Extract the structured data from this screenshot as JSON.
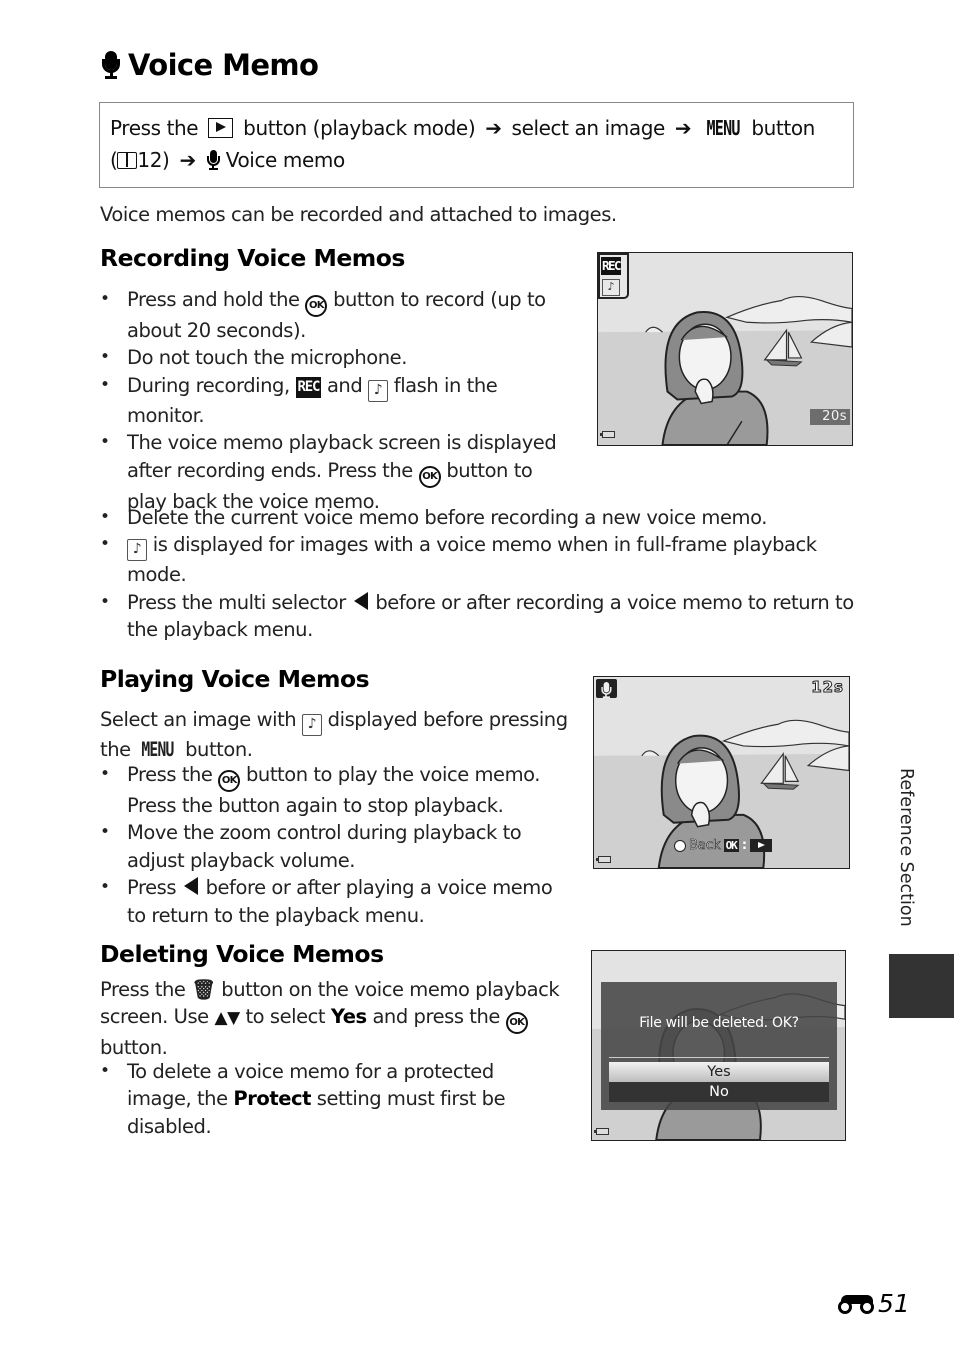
{
  "page": {
    "title": "Voice Memo",
    "title_icon": "microphone-icon",
    "nav": {
      "press_the": "Press the",
      "playback_button_icon": "playback-button-icon",
      "button_playback_mode": "button (playback mode)",
      "arrow": "➔",
      "select_image": "select an image",
      "menu_glyph": "MENU",
      "button": "button",
      "ref_open": "(",
      "ref_icon": "book-icon",
      "ref_page": "12)",
      "voice_memo": "Voice memo"
    },
    "intro": "Voice memos can be recorded and attached to images.",
    "side_tab_label": "Reference Section",
    "page_number_prefix_icon": "binoculars-icon",
    "page_number": "51"
  },
  "recording": {
    "heading": "Recording Voice Memos",
    "b1a": "Press and hold the",
    "b1b": "button to record (up to about 20 seconds).",
    "b2": "Do not touch the microphone.",
    "b3a": "During recording,",
    "b3b": "and",
    "b3c": "flash in the monitor.",
    "b4a": "The voice memo playback screen is displayed after recording ends. Press the",
    "b4b": "button to play back the voice memo.",
    "b5": "Delete the current voice memo before recording a new voice memo.",
    "b6": "is displayed for images with a voice memo when in full-frame playback mode.",
    "b7a": "Press the multi selector",
    "b7b": "before or after recording a voice memo to return to the playback menu.",
    "screen": {
      "rec_label": "REC",
      "note_icon": "♪",
      "time": "20s"
    }
  },
  "playing": {
    "heading": "Playing Voice Memos",
    "intro_a": "Select an image with",
    "intro_b": "displayed before pressing the",
    "intro_menu": "MENU",
    "intro_c": "button.",
    "b1a": "Press the",
    "b1b": "button to play the voice memo. Press the button again to stop playback.",
    "b2": "Move the zoom control during playback to adjust playback volume.",
    "b3a": "Press",
    "b3b": "before or after playing a voice memo to return to the playback menu.",
    "screen": {
      "time": "12s",
      "back_label": "Back",
      "ok_label": "OK",
      "colon": ":"
    }
  },
  "deleting": {
    "heading": "Deleting Voice Memos",
    "p_a": "Press the",
    "p_b": "button on the voice memo playback screen. Use",
    "p_updown": "▲▼",
    "p_c": "to select",
    "p_yes": "Yes",
    "p_d": "and press the",
    "p_e": "button.",
    "b1a": "To delete a voice memo for a protected image, the",
    "b1_protect": "Protect",
    "b1b": "setting must first be disabled.",
    "screen": {
      "message": "File will be deleted. OK?",
      "options": [
        "Yes",
        "No"
      ],
      "selected": "Yes"
    }
  },
  "glyphs": {
    "ok": "OK",
    "rec": "REC",
    "note": "♪",
    "trash": "🗑"
  }
}
